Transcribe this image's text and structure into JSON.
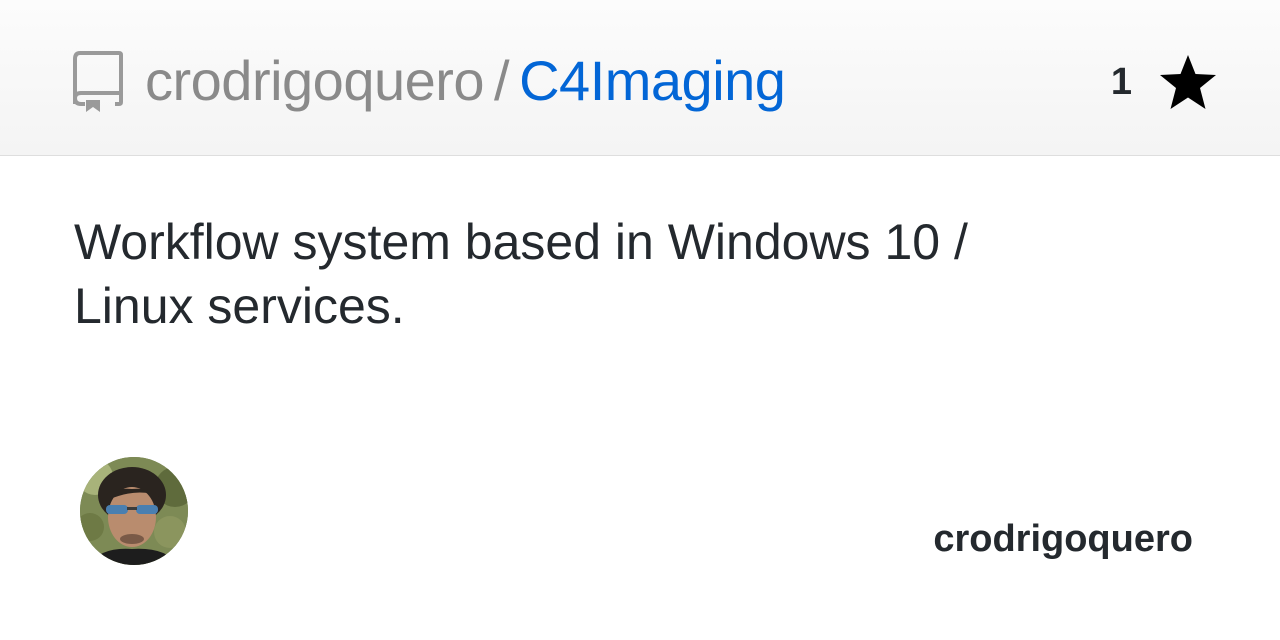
{
  "header": {
    "owner": "crodrigoquero",
    "separator": "/",
    "repo_name": "C4Imaging",
    "star_count": "1",
    "icons": {
      "repo": "repo-icon",
      "star": "star-icon"
    }
  },
  "description": {
    "line1": "Workflow system based in Windows 10 /",
    "line2": "Linux services."
  },
  "footer": {
    "avatar_icon": "avatar",
    "username": "crodrigoquero"
  },
  "colors": {
    "link": "#0366d6",
    "muted": "#8a8a8a",
    "text": "#24292e",
    "header_bg": "#f6f6f6"
  }
}
